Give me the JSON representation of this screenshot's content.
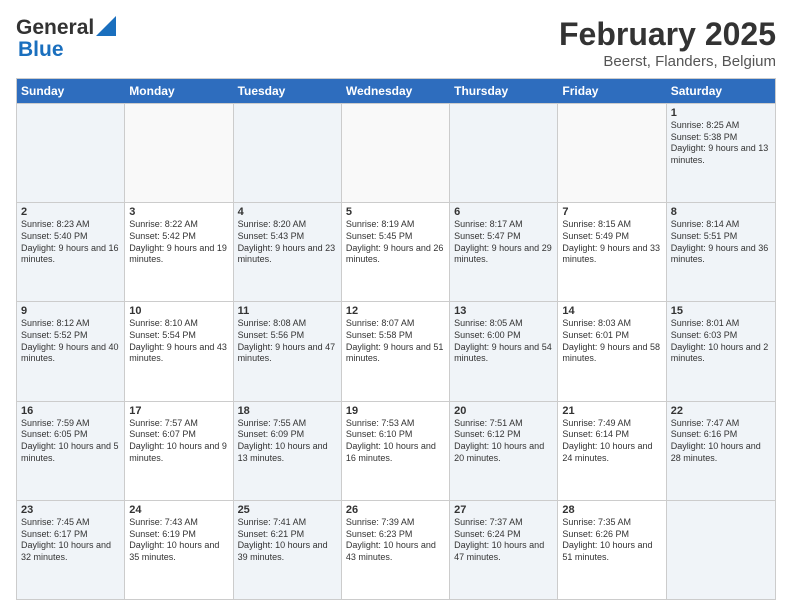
{
  "logo": {
    "line1": "General",
    "line2": "Blue"
  },
  "title": "February 2025",
  "subtitle": "Beerst, Flanders, Belgium",
  "days_of_week": [
    "Sunday",
    "Monday",
    "Tuesday",
    "Wednesday",
    "Thursday",
    "Friday",
    "Saturday"
  ],
  "weeks": [
    [
      {
        "day": "",
        "info": ""
      },
      {
        "day": "",
        "info": ""
      },
      {
        "day": "",
        "info": ""
      },
      {
        "day": "",
        "info": ""
      },
      {
        "day": "",
        "info": ""
      },
      {
        "day": "",
        "info": ""
      },
      {
        "day": "1",
        "info": "Sunrise: 8:25 AM\nSunset: 5:38 PM\nDaylight: 9 hours and 13 minutes."
      }
    ],
    [
      {
        "day": "2",
        "info": "Sunrise: 8:23 AM\nSunset: 5:40 PM\nDaylight: 9 hours and 16 minutes."
      },
      {
        "day": "3",
        "info": "Sunrise: 8:22 AM\nSunset: 5:42 PM\nDaylight: 9 hours and 19 minutes."
      },
      {
        "day": "4",
        "info": "Sunrise: 8:20 AM\nSunset: 5:43 PM\nDaylight: 9 hours and 23 minutes."
      },
      {
        "day": "5",
        "info": "Sunrise: 8:19 AM\nSunset: 5:45 PM\nDaylight: 9 hours and 26 minutes."
      },
      {
        "day": "6",
        "info": "Sunrise: 8:17 AM\nSunset: 5:47 PM\nDaylight: 9 hours and 29 minutes."
      },
      {
        "day": "7",
        "info": "Sunrise: 8:15 AM\nSunset: 5:49 PM\nDaylight: 9 hours and 33 minutes."
      },
      {
        "day": "8",
        "info": "Sunrise: 8:14 AM\nSunset: 5:51 PM\nDaylight: 9 hours and 36 minutes."
      }
    ],
    [
      {
        "day": "9",
        "info": "Sunrise: 8:12 AM\nSunset: 5:52 PM\nDaylight: 9 hours and 40 minutes."
      },
      {
        "day": "10",
        "info": "Sunrise: 8:10 AM\nSunset: 5:54 PM\nDaylight: 9 hours and 43 minutes."
      },
      {
        "day": "11",
        "info": "Sunrise: 8:08 AM\nSunset: 5:56 PM\nDaylight: 9 hours and 47 minutes."
      },
      {
        "day": "12",
        "info": "Sunrise: 8:07 AM\nSunset: 5:58 PM\nDaylight: 9 hours and 51 minutes."
      },
      {
        "day": "13",
        "info": "Sunrise: 8:05 AM\nSunset: 6:00 PM\nDaylight: 9 hours and 54 minutes."
      },
      {
        "day": "14",
        "info": "Sunrise: 8:03 AM\nSunset: 6:01 PM\nDaylight: 9 hours and 58 minutes."
      },
      {
        "day": "15",
        "info": "Sunrise: 8:01 AM\nSunset: 6:03 PM\nDaylight: 10 hours and 2 minutes."
      }
    ],
    [
      {
        "day": "16",
        "info": "Sunrise: 7:59 AM\nSunset: 6:05 PM\nDaylight: 10 hours and 5 minutes."
      },
      {
        "day": "17",
        "info": "Sunrise: 7:57 AM\nSunset: 6:07 PM\nDaylight: 10 hours and 9 minutes."
      },
      {
        "day": "18",
        "info": "Sunrise: 7:55 AM\nSunset: 6:09 PM\nDaylight: 10 hours and 13 minutes."
      },
      {
        "day": "19",
        "info": "Sunrise: 7:53 AM\nSunset: 6:10 PM\nDaylight: 10 hours and 16 minutes."
      },
      {
        "day": "20",
        "info": "Sunrise: 7:51 AM\nSunset: 6:12 PM\nDaylight: 10 hours and 20 minutes."
      },
      {
        "day": "21",
        "info": "Sunrise: 7:49 AM\nSunset: 6:14 PM\nDaylight: 10 hours and 24 minutes."
      },
      {
        "day": "22",
        "info": "Sunrise: 7:47 AM\nSunset: 6:16 PM\nDaylight: 10 hours and 28 minutes."
      }
    ],
    [
      {
        "day": "23",
        "info": "Sunrise: 7:45 AM\nSunset: 6:17 PM\nDaylight: 10 hours and 32 minutes."
      },
      {
        "day": "24",
        "info": "Sunrise: 7:43 AM\nSunset: 6:19 PM\nDaylight: 10 hours and 35 minutes."
      },
      {
        "day": "25",
        "info": "Sunrise: 7:41 AM\nSunset: 6:21 PM\nDaylight: 10 hours and 39 minutes."
      },
      {
        "day": "26",
        "info": "Sunrise: 7:39 AM\nSunset: 6:23 PM\nDaylight: 10 hours and 43 minutes."
      },
      {
        "day": "27",
        "info": "Sunrise: 7:37 AM\nSunset: 6:24 PM\nDaylight: 10 hours and 47 minutes."
      },
      {
        "day": "28",
        "info": "Sunrise: 7:35 AM\nSunset: 6:26 PM\nDaylight: 10 hours and 51 minutes."
      },
      {
        "day": "",
        "info": ""
      }
    ]
  ]
}
